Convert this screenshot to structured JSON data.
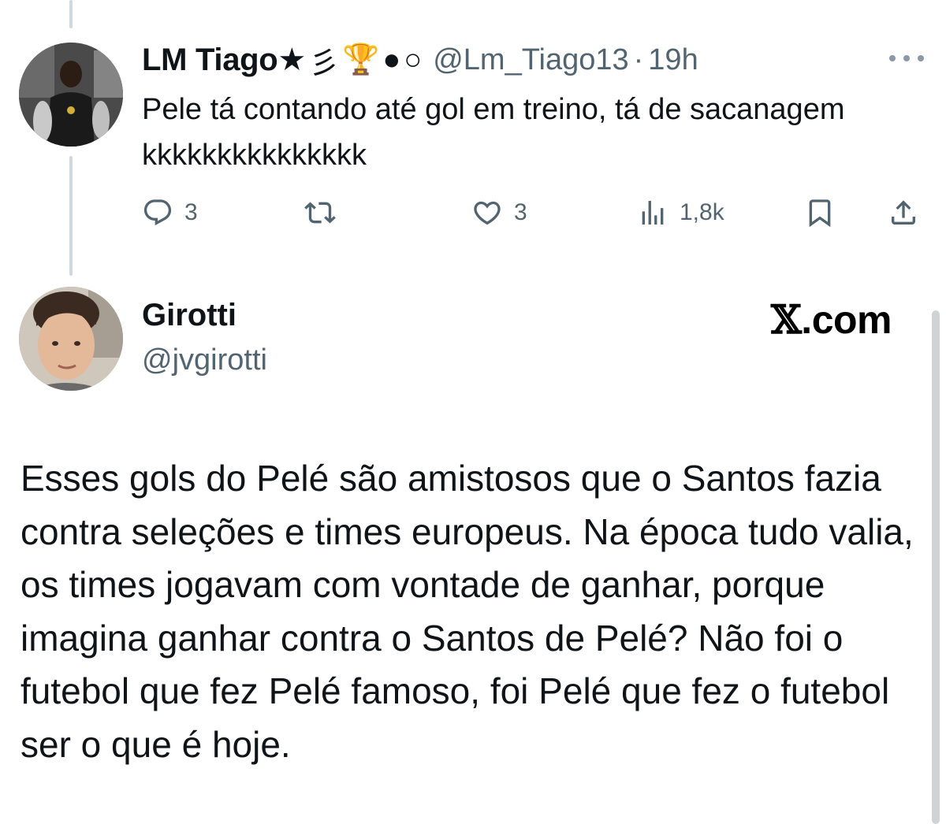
{
  "tweet1": {
    "display_name": "LM Tiago★",
    "emoji_badges": [
      "彡",
      "🏆",
      "●",
      "○"
    ],
    "handle": "@Lm_Tiago13",
    "separator": "·",
    "time": "19h",
    "text": "Pele tá contando até gol em treino, tá de sacanagem kkkkkkkkkkkkkkk",
    "actions": {
      "replies": "3",
      "reposts": "",
      "likes": "3",
      "views": "1,8k"
    },
    "icons": [
      "reply-icon",
      "repost-icon",
      "like-icon",
      "views-icon",
      "bookmark-icon",
      "share-icon",
      "more-icon"
    ]
  },
  "tweet2": {
    "display_name": "Girotti",
    "handle": "@jvgirotti",
    "brand": {
      "glyph": "𝕏",
      "text": ".com"
    },
    "text": "Esses gols do Pelé são amistosos que o Santos fazia contra seleções e times europeus. Na época tudo valia, os times jogavam com vontade de ganhar, porque imagina ganhar contra o Santos de Pelé? Não foi o futebol que fez Pelé famoso, foi Pelé que fez o futebol ser o que é hoje."
  },
  "colors": {
    "text_primary": "#0f1419",
    "text_secondary": "#536471",
    "thread_line": "#cfd9de",
    "background": "#ffffff"
  }
}
